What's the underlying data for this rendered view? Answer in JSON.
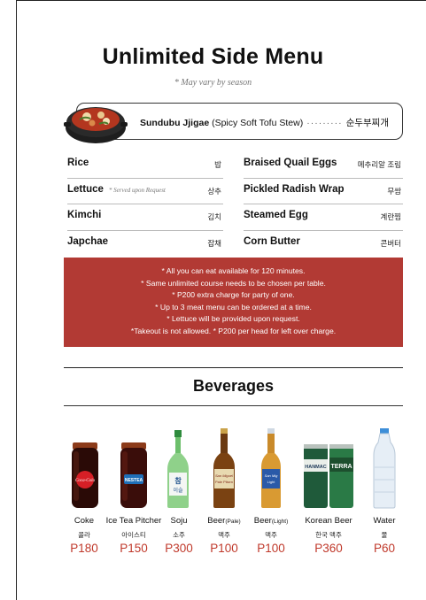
{
  "header": {
    "title": "Unlimited Side Menu",
    "subtitle": "* May vary by season"
  },
  "featured": {
    "name_bold": "Sundubu Jjigae",
    "name_rest": "(Spicy Soft Tofu Stew)",
    "dots": "·········",
    "korean": "순두부찌개",
    "icon": "stew-pot-image"
  },
  "menu": {
    "left": [
      {
        "en": "Rice",
        "note": "",
        "kr": "밥"
      },
      {
        "en": "Lettuce",
        "note": "* Served upon Request",
        "kr": "상추"
      },
      {
        "en": "Kimchi",
        "note": "",
        "kr": "김치"
      },
      {
        "en": "Japchae",
        "note": "",
        "kr": "잡채"
      }
    ],
    "right": [
      {
        "en": "Braised Quail Eggs",
        "kr": "메추리알 조림"
      },
      {
        "en": "Pickled Radish Wrap",
        "kr": "무쌈"
      },
      {
        "en": "Steamed Egg",
        "kr": "계란찜"
      },
      {
        "en": "Corn Butter",
        "kr": "콘버터"
      }
    ]
  },
  "notice": {
    "lines": [
      "* All you can eat available for 120 minutes.",
      "* Same unlimited course needs to be chosen per table.",
      "* P200 extra charge for party of one.",
      "* Up to 3 meat menu can be ordered at a time.",
      "* Lettuce will be provided upon request.",
      "*Takeout is not allowed.  * P200 per head for left over charge."
    ],
    "bg_color": "#b23a34"
  },
  "beverages": {
    "title": "Beverages",
    "items": [
      {
        "name": "Coke",
        "sub": "",
        "kr": "콜라",
        "price": "P180",
        "icon": "coke-jar-icon",
        "brand": "Coca-Cola"
      },
      {
        "name": "Ice Tea Pitcher",
        "sub": "",
        "kr": "아이스티",
        "price": "P150",
        "icon": "ice-tea-jar-icon",
        "brand": "NESTEA"
      },
      {
        "name": "Soju",
        "sub": "",
        "kr": "소주",
        "price": "P300",
        "icon": "soju-bottle-icon",
        "brand": "참이슬"
      },
      {
        "name": "Beer",
        "sub": "(Pale)",
        "kr": "맥주",
        "price": "P100",
        "icon": "pale-beer-bottle-icon",
        "brand": "San Miguel Pale Pilsen"
      },
      {
        "name": "Beer",
        "sub": "(Light)",
        "kr": "맥주",
        "price": "P100",
        "icon": "light-beer-bottle-icon",
        "brand": "San Mig Light"
      },
      {
        "name": "Korean Beer",
        "sub": "",
        "kr": "한국 맥주",
        "price": "P360",
        "icon": "korean-beer-cans-icon",
        "brand_a": "HANMAC",
        "brand_b": "TERRA"
      },
      {
        "name": "Water",
        "sub": "",
        "kr": "물",
        "price": "P60",
        "icon": "water-bottle-icon",
        "brand": ""
      }
    ],
    "price_color": "#c0392b"
  }
}
